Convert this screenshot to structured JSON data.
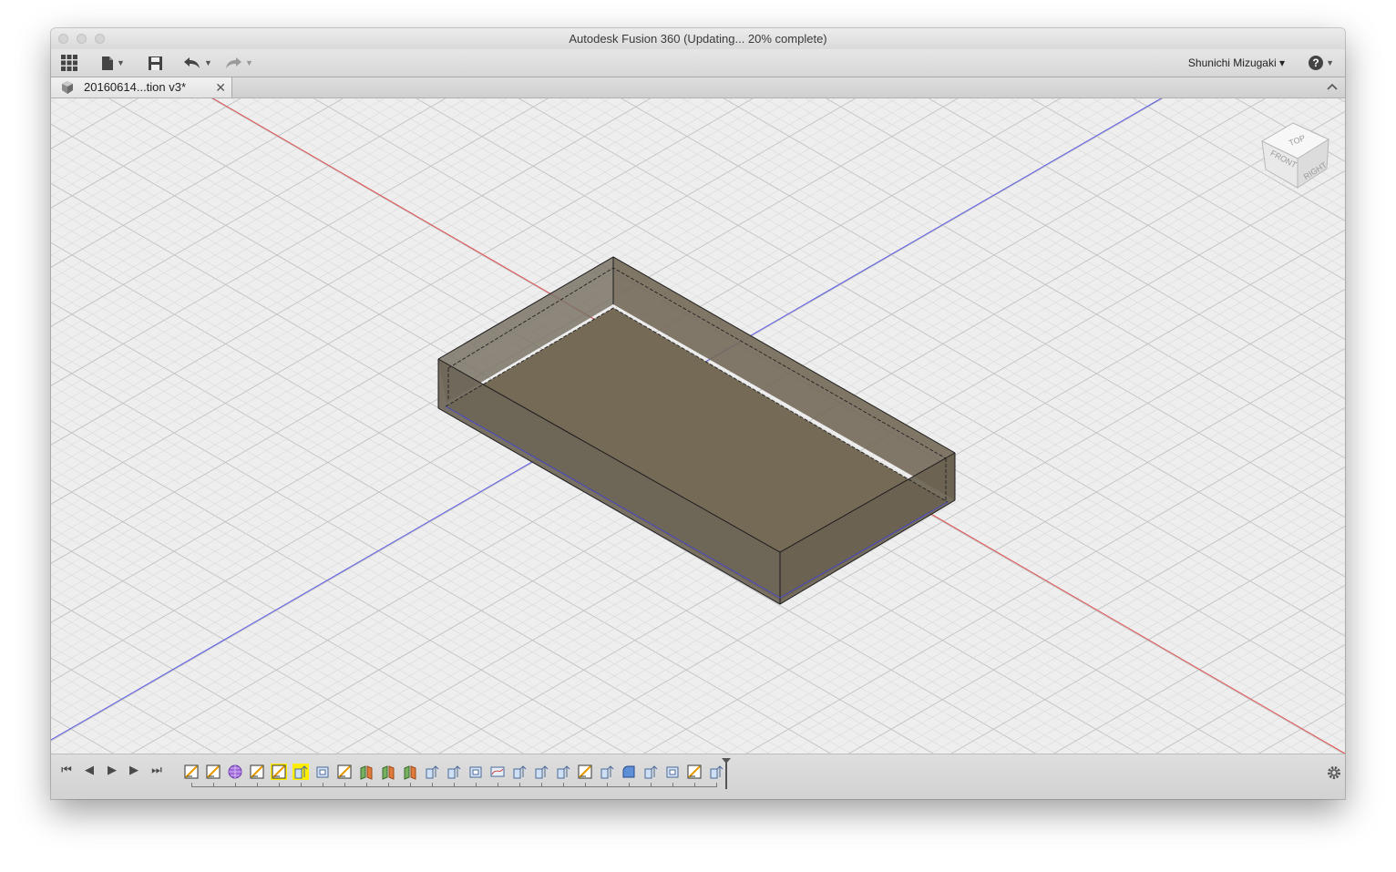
{
  "app": {
    "window_title": "Autodesk Fusion 360  (Updating... 20% complete)",
    "user_name": "Shunichi Mizugaki ▾",
    "help_label": "?"
  },
  "toolbar": {
    "icons": [
      "data-panel-grid-icon",
      "file-menu-icon",
      "save-icon",
      "undo-icon",
      "redo-icon"
    ]
  },
  "document_tab": {
    "label": "20160614...tion v3*",
    "close_glyph": "✕"
  },
  "viewcube": {
    "top": "TOP",
    "front": "FRONT",
    "right": "RIGHT"
  },
  "timeline": {
    "controls": [
      "⏮",
      "◀",
      "▶",
      "▶",
      "⏭"
    ],
    "features": [
      {
        "kind": "sketch",
        "highlight": false
      },
      {
        "kind": "sketch",
        "highlight": false
      },
      {
        "kind": "mesh",
        "highlight": false
      },
      {
        "kind": "sketch",
        "highlight": false
      },
      {
        "kind": "sketch",
        "highlight": true
      },
      {
        "kind": "extrude",
        "highlight": true
      },
      {
        "kind": "component",
        "highlight": false
      },
      {
        "kind": "sketch",
        "highlight": false
      },
      {
        "kind": "split",
        "highlight": false
      },
      {
        "kind": "split",
        "highlight": false
      },
      {
        "kind": "split",
        "highlight": false
      },
      {
        "kind": "extrude",
        "highlight": false
      },
      {
        "kind": "extrude",
        "highlight": false
      },
      {
        "kind": "component",
        "highlight": false
      },
      {
        "kind": "loft",
        "highlight": false
      },
      {
        "kind": "extrude",
        "highlight": false
      },
      {
        "kind": "extrude",
        "highlight": false
      },
      {
        "kind": "extrude",
        "highlight": false
      },
      {
        "kind": "sketch",
        "highlight": false
      },
      {
        "kind": "extrude",
        "highlight": false
      },
      {
        "kind": "fillet",
        "highlight": false
      },
      {
        "kind": "extrude",
        "highlight": false
      },
      {
        "kind": "component",
        "highlight": false
      },
      {
        "kind": "sketch",
        "highlight": false
      },
      {
        "kind": "extrude",
        "highlight": false
      }
    ]
  },
  "colors": {
    "x_axis": "#e05050",
    "z_axis": "#5a5ae8",
    "body_top": "#6f6656",
    "highlight": "#ffee00"
  }
}
